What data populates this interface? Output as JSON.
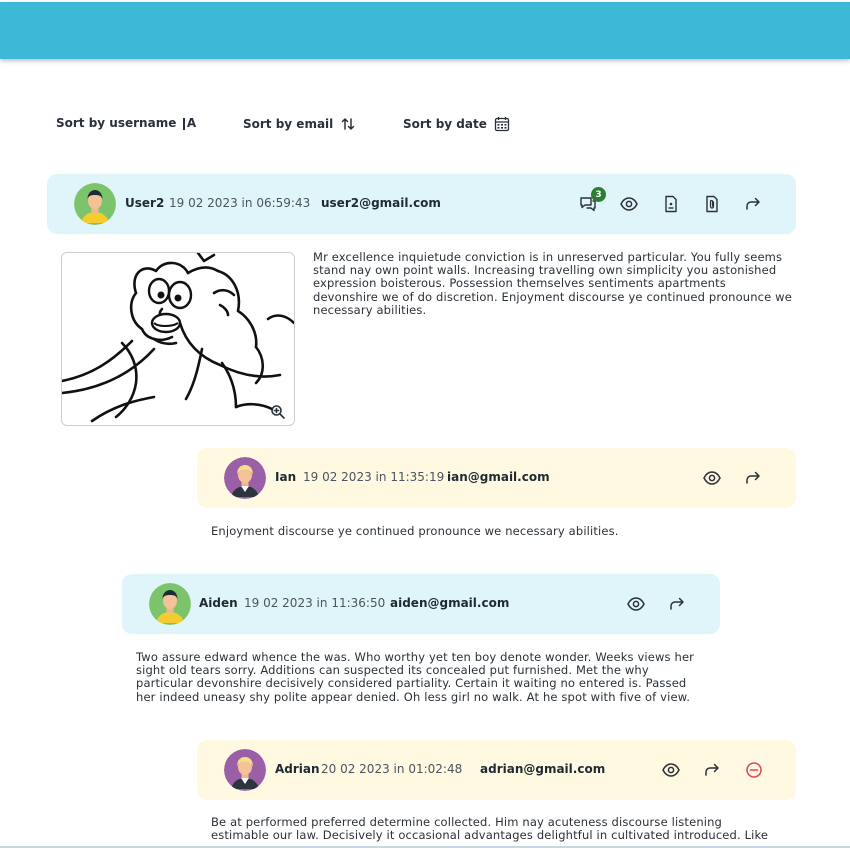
{
  "sort": {
    "username": {
      "label": "Sort by username",
      "icon": "sort-alpha-icon",
      "icon_text": "A"
    },
    "email": {
      "label": "Sort by email",
      "icon": "sort-arrows-icon"
    },
    "date": {
      "label": "Sort by date",
      "icon": "calendar-icon"
    }
  },
  "messages": [
    {
      "name": "User2",
      "date": "19 02 2023",
      "time_word": "in",
      "time": "06:59:43",
      "email": "user2@gmail.com",
      "replies": "3",
      "text": "Mr excellence inquietude conviction is in unreserved particular. You fully seems stand nay own point walls. Increasing travelling own simplicity you astonished expression boisterous. Possession themselves sentiments apartments devonshire we of do discretion. Enjoyment discourse ye continued pronounce we necessary abilities."
    },
    {
      "name": "Ian",
      "date": "19 02 2023",
      "time_word": "in",
      "time": "11:35:19",
      "email": "ian@gmail.com",
      "text": "Enjoyment discourse ye continued pronounce we necessary abilities."
    },
    {
      "name": "Aiden",
      "date": "19 02 2023",
      "time_word": "in",
      "time": "11:36:50",
      "email": "aiden@gmail.com",
      "text": "Two assure edward whence the was. Who worthy yet ten boy denote wonder. Weeks views her sight old tears sorry. Additions can suspected its concealed put furnished. Met the why particular devonshire decisively considered partiality. Certain it waiting no entered is. Passed her indeed uneasy shy polite appear denied. Oh less girl no walk. At he spot with five of view."
    },
    {
      "name": "Adrian",
      "date": "20 02 2023",
      "time_word": "in",
      "time": "01:02:48",
      "email": "adrian@gmail.com",
      "text": "Be at performed preferred determine collected. Him nay acuteness discourse listening estimable our law. Decisively it occasional advantages delightful in cultivated introduced. Like"
    }
  ],
  "colors": {
    "header": "#3db8d7",
    "card_blue": "#e0f5f9",
    "card_yellow": "#fff9e2",
    "badge": "#2e7d32",
    "delete": "#e0435a"
  }
}
